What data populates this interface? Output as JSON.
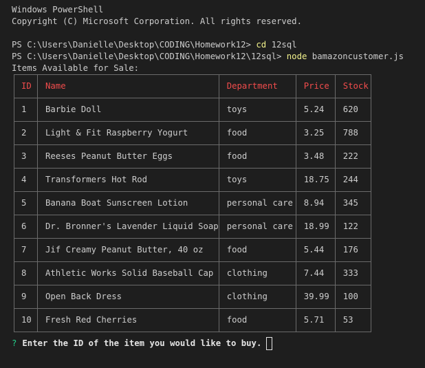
{
  "header": {
    "title": "Windows PowerShell",
    "copyright": "Copyright (C) Microsoft Corporation. All rights reserved."
  },
  "commands": [
    {
      "prompt": "PS C:\\Users\\Danielle\\Desktop\\CODING\\Homework12> ",
      "cmd": "cd",
      "args": " 12sql"
    },
    {
      "prompt": "PS C:\\Users\\Danielle\\Desktop\\CODING\\Homework12\\12sql> ",
      "cmd": "node",
      "args": " bamazoncustomer.js"
    }
  ],
  "output": {
    "heading": "Items Available for Sale:"
  },
  "table": {
    "headers": {
      "id": "ID",
      "name": "Name",
      "department": "Department",
      "price": "Price",
      "stock": "Stock"
    },
    "rows": [
      {
        "id": "1",
        "name": "Barbie Doll",
        "department": "toys",
        "price": "5.24",
        "stock": "620"
      },
      {
        "id": "2",
        "name": "Light & Fit Raspberry Yogurt",
        "department": "food",
        "price": "3.25",
        "stock": "788"
      },
      {
        "id": "3",
        "name": "Reeses Peanut Butter Eggs",
        "department": "food",
        "price": "3.48",
        "stock": "222"
      },
      {
        "id": "4",
        "name": "Transformers Hot Rod",
        "department": "toys",
        "price": "18.75",
        "stock": "244"
      },
      {
        "id": "5",
        "name": "Banana Boat Sunscreen Lotion",
        "department": "personal care",
        "price": "8.94",
        "stock": "345"
      },
      {
        "id": "6",
        "name": "Dr. Bronner's Lavender Liquid Soap",
        "department": "personal care",
        "price": "18.99",
        "stock": "122"
      },
      {
        "id": "7",
        "name": "Jif Creamy Peanut Butter, 40 oz",
        "department": "food",
        "price": "5.44",
        "stock": "176"
      },
      {
        "id": "8",
        "name": "Athletic Works Solid Baseball Cap",
        "department": "clothing",
        "price": "7.44",
        "stock": "333"
      },
      {
        "id": "9",
        "name": "Open Back Dress",
        "department": "clothing",
        "price": "39.99",
        "stock": "100"
      },
      {
        "id": "10",
        "name": "Fresh Red Cherries",
        "department": "food",
        "price": "5.71",
        "stock": "53"
      }
    ]
  },
  "prompt": {
    "symbol": "?",
    "question": "Enter the ID of the item you would like to buy.",
    "input_value": ""
  },
  "colors": {
    "background": "#1e1e1e",
    "text": "#cccccc",
    "command": "#f2f28c",
    "table_header": "#f14c4c",
    "question_mark": "#23d18b"
  }
}
